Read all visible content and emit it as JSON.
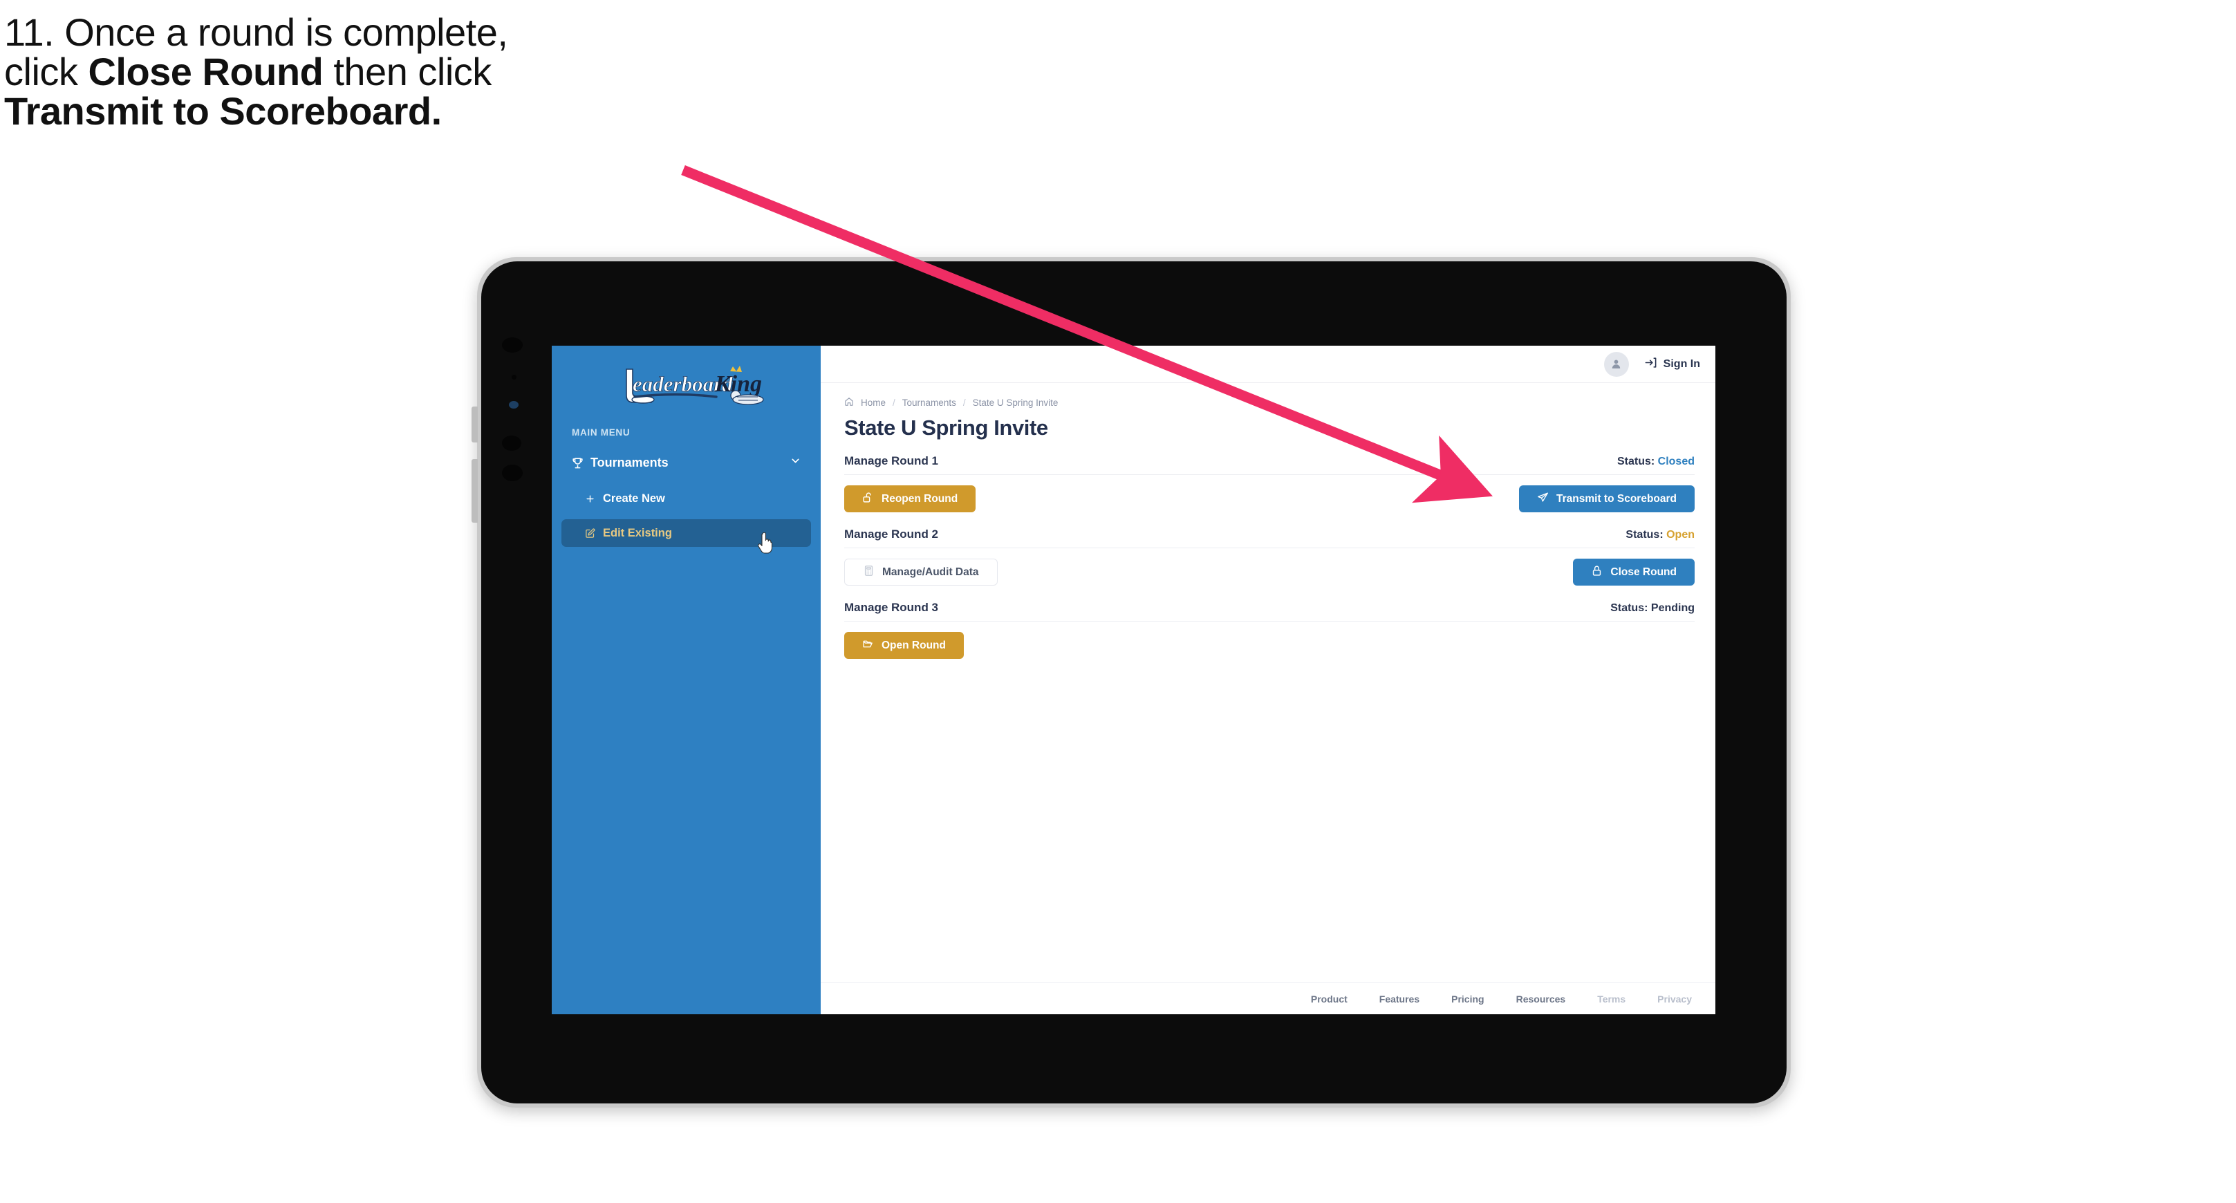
{
  "caption": {
    "line1": "11. Once a round is complete,",
    "line2_pre": "click ",
    "line2_bold": "Close Round",
    "line2_post": " then click",
    "line3_bold": "Transmit to Scoreboard."
  },
  "annotation": {
    "arrow_color": "#ef2d64"
  },
  "app": {
    "sidebar": {
      "logo_primary": "Leaderboard",
      "logo_secondary": "King",
      "menu_label": "MAIN MENU",
      "items": [
        {
          "label": "Tournaments",
          "icon": "trophy-icon",
          "chevron": "chevron-down-icon",
          "active": false
        },
        {
          "label": "Create New",
          "icon": "plus-icon",
          "active": false
        },
        {
          "label": "Edit Existing",
          "icon": "edit-square-icon",
          "active": true
        }
      ],
      "bg_color": "#2e80c2",
      "active_bg": "#236193",
      "active_text": "#e7c982"
    },
    "topbar": {
      "avatar_icon": "user-avatar-icon",
      "signin_icon": "sign-in-arrow-icon",
      "signin_label": "Sign In"
    },
    "breadcrumb": {
      "home_icon": "home-icon",
      "items": [
        "Home",
        "Tournaments",
        "State U Spring Invite"
      ],
      "separator": "/"
    },
    "page_title": "State U Spring Invite",
    "rounds": [
      {
        "title": "Manage Round 1",
        "status_label": "Status:",
        "status_value": "Closed",
        "status_color": "#2f80bf",
        "left_button": {
          "label": "Reopen Round",
          "icon": "unlock-icon",
          "style": "gold"
        },
        "right_button": {
          "label": "Transmit to Scoreboard",
          "icon": "paper-plane-icon",
          "style": "blue"
        }
      },
      {
        "title": "Manage Round 2",
        "status_label": "Status:",
        "status_value": "Open",
        "status_color": "#d6a12f",
        "left_button": {
          "label": "Manage/Audit Data",
          "icon": "spreadsheet-icon",
          "style": "ghost"
        },
        "right_button": {
          "label": "Close Round",
          "icon": "lock-icon",
          "style": "blue"
        }
      },
      {
        "title": "Manage Round 3",
        "status_label": "Status:",
        "status_value": "Pending",
        "status_color": "#2b3550",
        "left_button": {
          "label": "Open Round",
          "icon": "folder-open-icon",
          "style": "gold"
        },
        "right_button": null
      }
    ],
    "footer": {
      "links": [
        {
          "label": "Product",
          "dim": false
        },
        {
          "label": "Features",
          "dim": false
        },
        {
          "label": "Pricing",
          "dim": false
        },
        {
          "label": "Resources",
          "dim": false
        },
        {
          "label": "Terms",
          "dim": true
        },
        {
          "label": "Privacy",
          "dim": true
        }
      ]
    }
  }
}
